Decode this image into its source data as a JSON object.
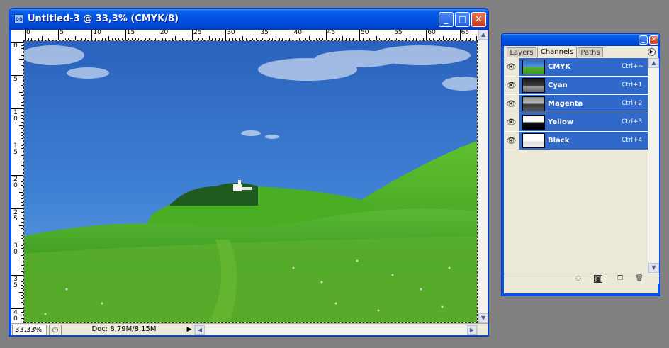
{
  "document_window": {
    "title": "Untitled-3 @ 33,3% (CMYK/8)",
    "controls": {
      "minimize": "minimize-icon",
      "maximize": "maximize-icon",
      "close": "close-icon"
    },
    "ruler_h_labels": [
      "0",
      "5",
      "10",
      "15",
      "20",
      "25",
      "30",
      "35",
      "40",
      "45",
      "50",
      "55",
      "60",
      "65"
    ],
    "ruler_v_labels": [
      "0",
      "5",
      "10",
      "15",
      "20",
      "25",
      "30",
      "35",
      "40"
    ],
    "status": {
      "zoom": "33,33%",
      "doc_info": "Doc: 8,79M/8,15M"
    }
  },
  "channels_palette": {
    "tabs": [
      {
        "label": "Layers"
      },
      {
        "label": "Channels"
      },
      {
        "label": "Paths"
      }
    ],
    "active_tab": "Channels",
    "channels": [
      {
        "name": "CMYK",
        "shortcut": "Ctrl+~"
      },
      {
        "name": "Cyan",
        "shortcut": "Ctrl+1"
      },
      {
        "name": "Magenta",
        "shortcut": "Ctrl+2"
      },
      {
        "name": "Yellow",
        "shortcut": "Ctrl+3"
      },
      {
        "name": "Black",
        "shortcut": "Ctrl+4"
      }
    ],
    "bottom_icons": [
      "load-selection-icon",
      "save-selection-icon",
      "new-channel-icon",
      "delete-channel-icon"
    ]
  },
  "colors": {
    "titlebar": "#0054e3",
    "selected_row": "#3069c9",
    "panel_bg": "#ece9d8",
    "desktop": "#808080"
  }
}
